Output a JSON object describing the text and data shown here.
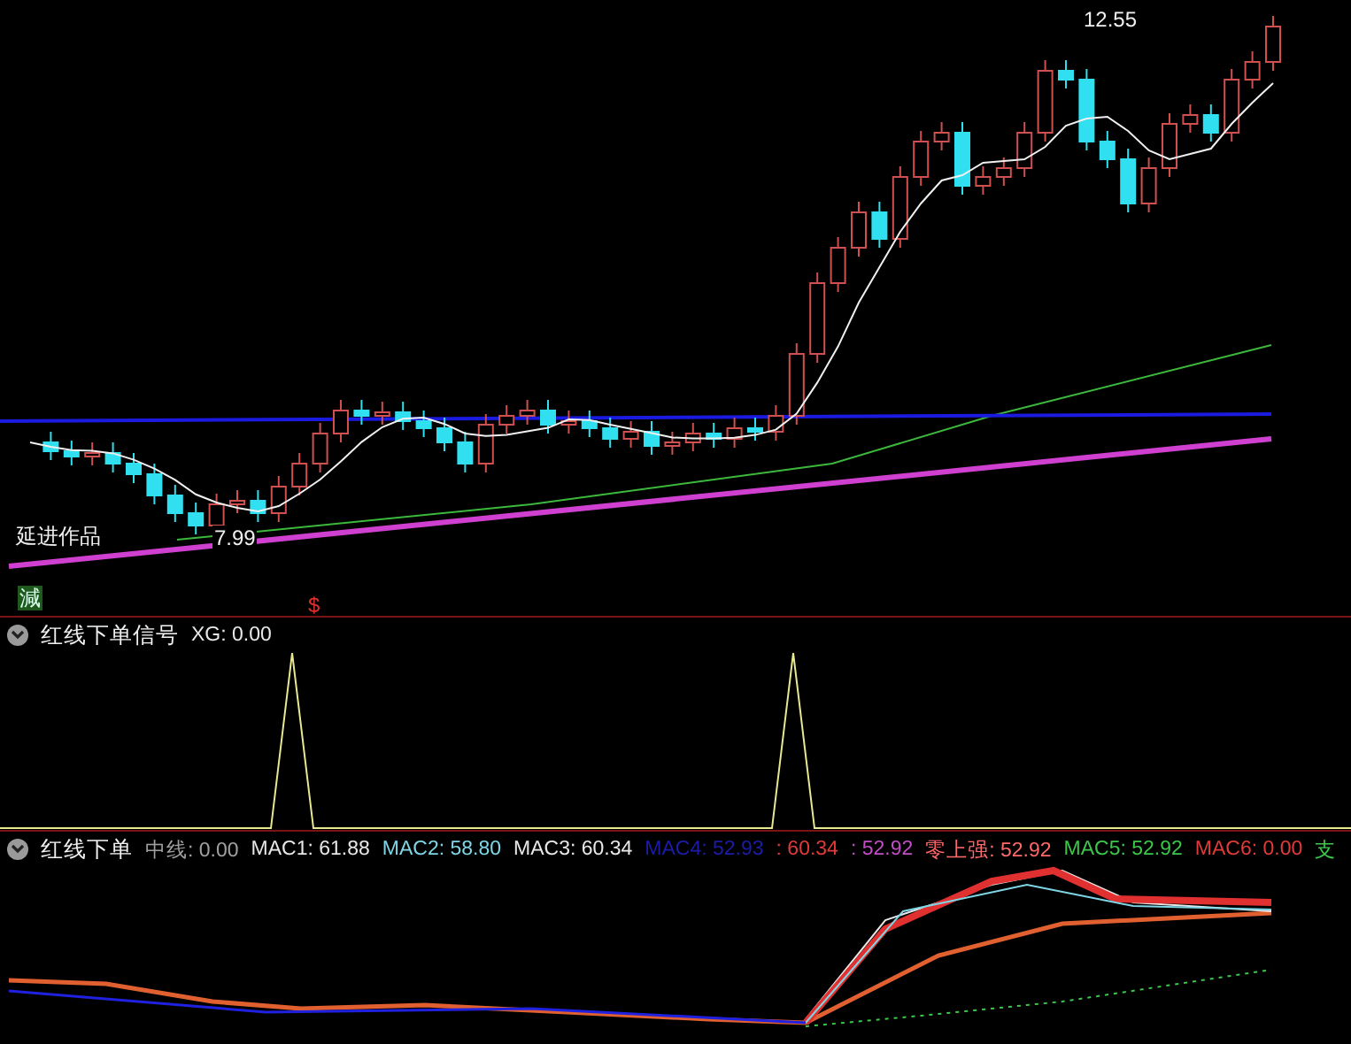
{
  "price_panel": {
    "high_label": "12.55",
    "low_label": "7.99",
    "author_label": "延进作品",
    "marker_left": "減",
    "marker_signal": "$"
  },
  "signal_panel": {
    "title": "红线下单信号",
    "readings": [
      {
        "text": "XG: 0.00",
        "color": "#e8e8e8"
      }
    ]
  },
  "mac_panel": {
    "title": "红线下单",
    "readings": [
      {
        "text": "中线: 0.00",
        "color": "#a0a0a0"
      },
      {
        "text": "MAC1: 61.88",
        "color": "#e8e8e8"
      },
      {
        "text": "MAC2: 58.80",
        "color": "#7fd6e6"
      },
      {
        "text": "MAC3: 60.34",
        "color": "#e8e8e8"
      },
      {
        "text": "MAC4: 52.93",
        "color": "#1c1caa"
      },
      {
        "text": ": 60.34",
        "color": "#e03a3a"
      },
      {
        "text": ": 52.92",
        "color": "#c24ec8"
      },
      {
        "text": "零上强: 52.92",
        "color": "#ff6a6a"
      },
      {
        "text": "MAC5: 52.92",
        "color": "#3cc84a"
      },
      {
        "text": "MAC6: 0.00",
        "color": "#e03a3a"
      },
      {
        "text": "支",
        "color": "#3cc84a"
      }
    ]
  }
}
